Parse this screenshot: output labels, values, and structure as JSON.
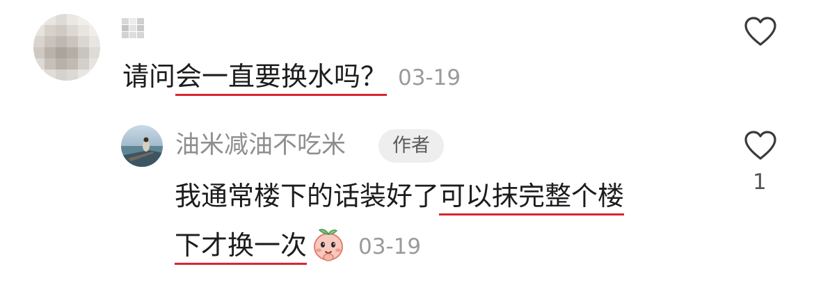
{
  "comment": {
    "text_plain": "请问",
    "text_underlined": "会一直要换水吗？",
    "date": "03-19",
    "like_icon": "heart-outline-icon"
  },
  "reply": {
    "username": "油米减油不吃米",
    "badge": "作者",
    "line1_plain": "我通常楼下的话装好了",
    "line1_underlined": "可以抹完整个楼",
    "line2_underlined": "下才换一次",
    "emoji": "peach-face-emoji-icon",
    "date": "03-19",
    "like_count": "1",
    "like_icon": "heart-outline-icon"
  },
  "colors": {
    "underline": "#d9252f",
    "muted_text": "#9a9a9a",
    "badge_bg": "#eeeeee"
  }
}
